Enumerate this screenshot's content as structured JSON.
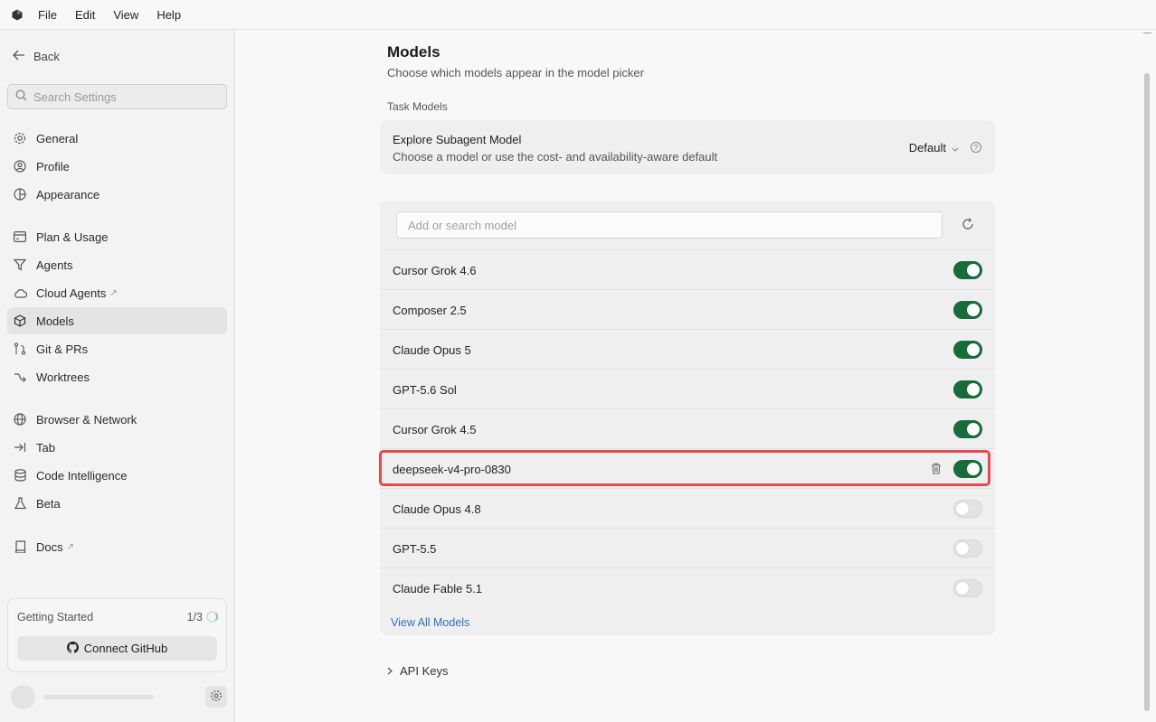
{
  "menu": {
    "file": "File",
    "edit": "Edit",
    "view": "View",
    "help": "Help"
  },
  "sidebar": {
    "back": "Back",
    "search_placeholder": "Search Settings",
    "items": {
      "general": "General",
      "profile": "Profile",
      "appearance": "Appearance",
      "plan": "Plan & Usage",
      "agents": "Agents",
      "cloud_agents": "Cloud Agents",
      "models": "Models",
      "git": "Git & PRs",
      "worktrees": "Worktrees",
      "browser": "Browser & Network",
      "tab": "Tab",
      "code_intel": "Code Intelligence",
      "beta": "Beta",
      "docs": "Docs"
    },
    "getting_started": {
      "title": "Getting Started",
      "count": "1/3",
      "button": "Connect GitHub"
    }
  },
  "main": {
    "title": "Models",
    "subtitle": "Choose which models appear in the model picker",
    "task_section": "Task Models",
    "task": {
      "title": "Explore Subagent Model",
      "description": "Choose a model or use the cost- and availability-aware default",
      "value": "Default"
    },
    "model_search_placeholder": "Add or search model",
    "models": [
      {
        "name": "Cursor Grok 4.6",
        "enabled": true
      },
      {
        "name": "Composer 2.5",
        "enabled": true
      },
      {
        "name": "Claude Opus 5",
        "enabled": true
      },
      {
        "name": "GPT-5.6 Sol",
        "enabled": true
      },
      {
        "name": "Cursor Grok 4.5",
        "enabled": true
      },
      {
        "name": "deepseek-v4-pro-0830",
        "enabled": true,
        "deletable": true,
        "highlighted": true
      },
      {
        "name": "Claude Opus 4.8",
        "enabled": false
      },
      {
        "name": "GPT-5.5",
        "enabled": false
      },
      {
        "name": "Claude Fable 5.1",
        "enabled": false
      }
    ],
    "view_all": "View All Models",
    "api_keys": "API Keys"
  },
  "colors": {
    "toggle_on": "#176c3a",
    "highlight": "#e5484d",
    "link": "#2f6fc0"
  }
}
